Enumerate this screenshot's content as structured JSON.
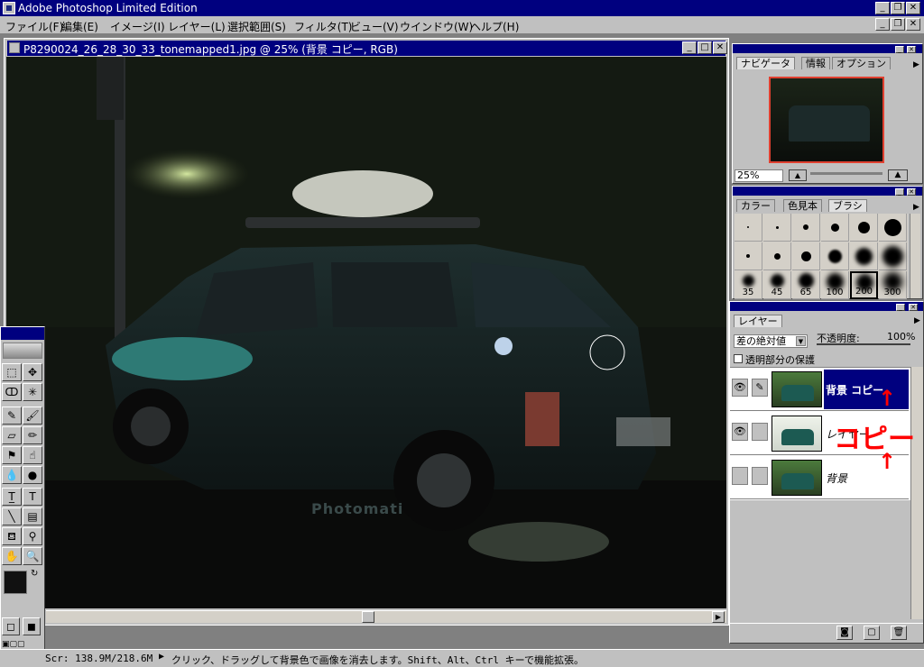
{
  "app": {
    "title": "Adobe Photoshop Limited Edition"
  },
  "menu": [
    "ファイル(F)",
    "編集(E)",
    "イメージ(I)",
    "レイヤー(L)",
    "選択範囲(S)",
    "フィルタ(T)",
    "ビュー(V)",
    "ウインドウ(W)",
    "ヘルプ(H)"
  ],
  "document": {
    "title": "P8290024_26_28_30_33_tonemapped1.jpg @ 25% (背景 コピー, RGB)",
    "watermark": "Photomati"
  },
  "status": {
    "scr": "Scr: 138.9M/218.6M",
    "hint": "クリック、ドラッグして背景色で画像を消去します。Shift、Alt、Ctrl キーで機能拡張。"
  },
  "navigator": {
    "tabs": [
      "ナビゲータ",
      "情報",
      "オプション"
    ],
    "zoom": "25%"
  },
  "brushes": {
    "tabs": [
      "カラー",
      "色見本",
      "ブラシ"
    ],
    "size_labels": [
      "35",
      "45",
      "65",
      "100",
      "200",
      "300"
    ]
  },
  "layers": {
    "tab": "レイヤー",
    "blend_mode": "差の絶対値",
    "opacity_label": "不透明度:",
    "opacity_value": "100%",
    "preserve_transparency": "透明部分の保護",
    "items": [
      {
        "name": "背景 コピー",
        "visible": true,
        "selected": true
      },
      {
        "name": "レイヤー",
        "visible": true,
        "selected": false
      },
      {
        "name": "背景",
        "visible": false,
        "selected": false
      }
    ]
  },
  "annotation": {
    "copy_label": "コピー"
  },
  "colors": {
    "titlebar": "#00007f",
    "chrome": "#c0c0c0",
    "annotation_red": "#ff0000"
  }
}
